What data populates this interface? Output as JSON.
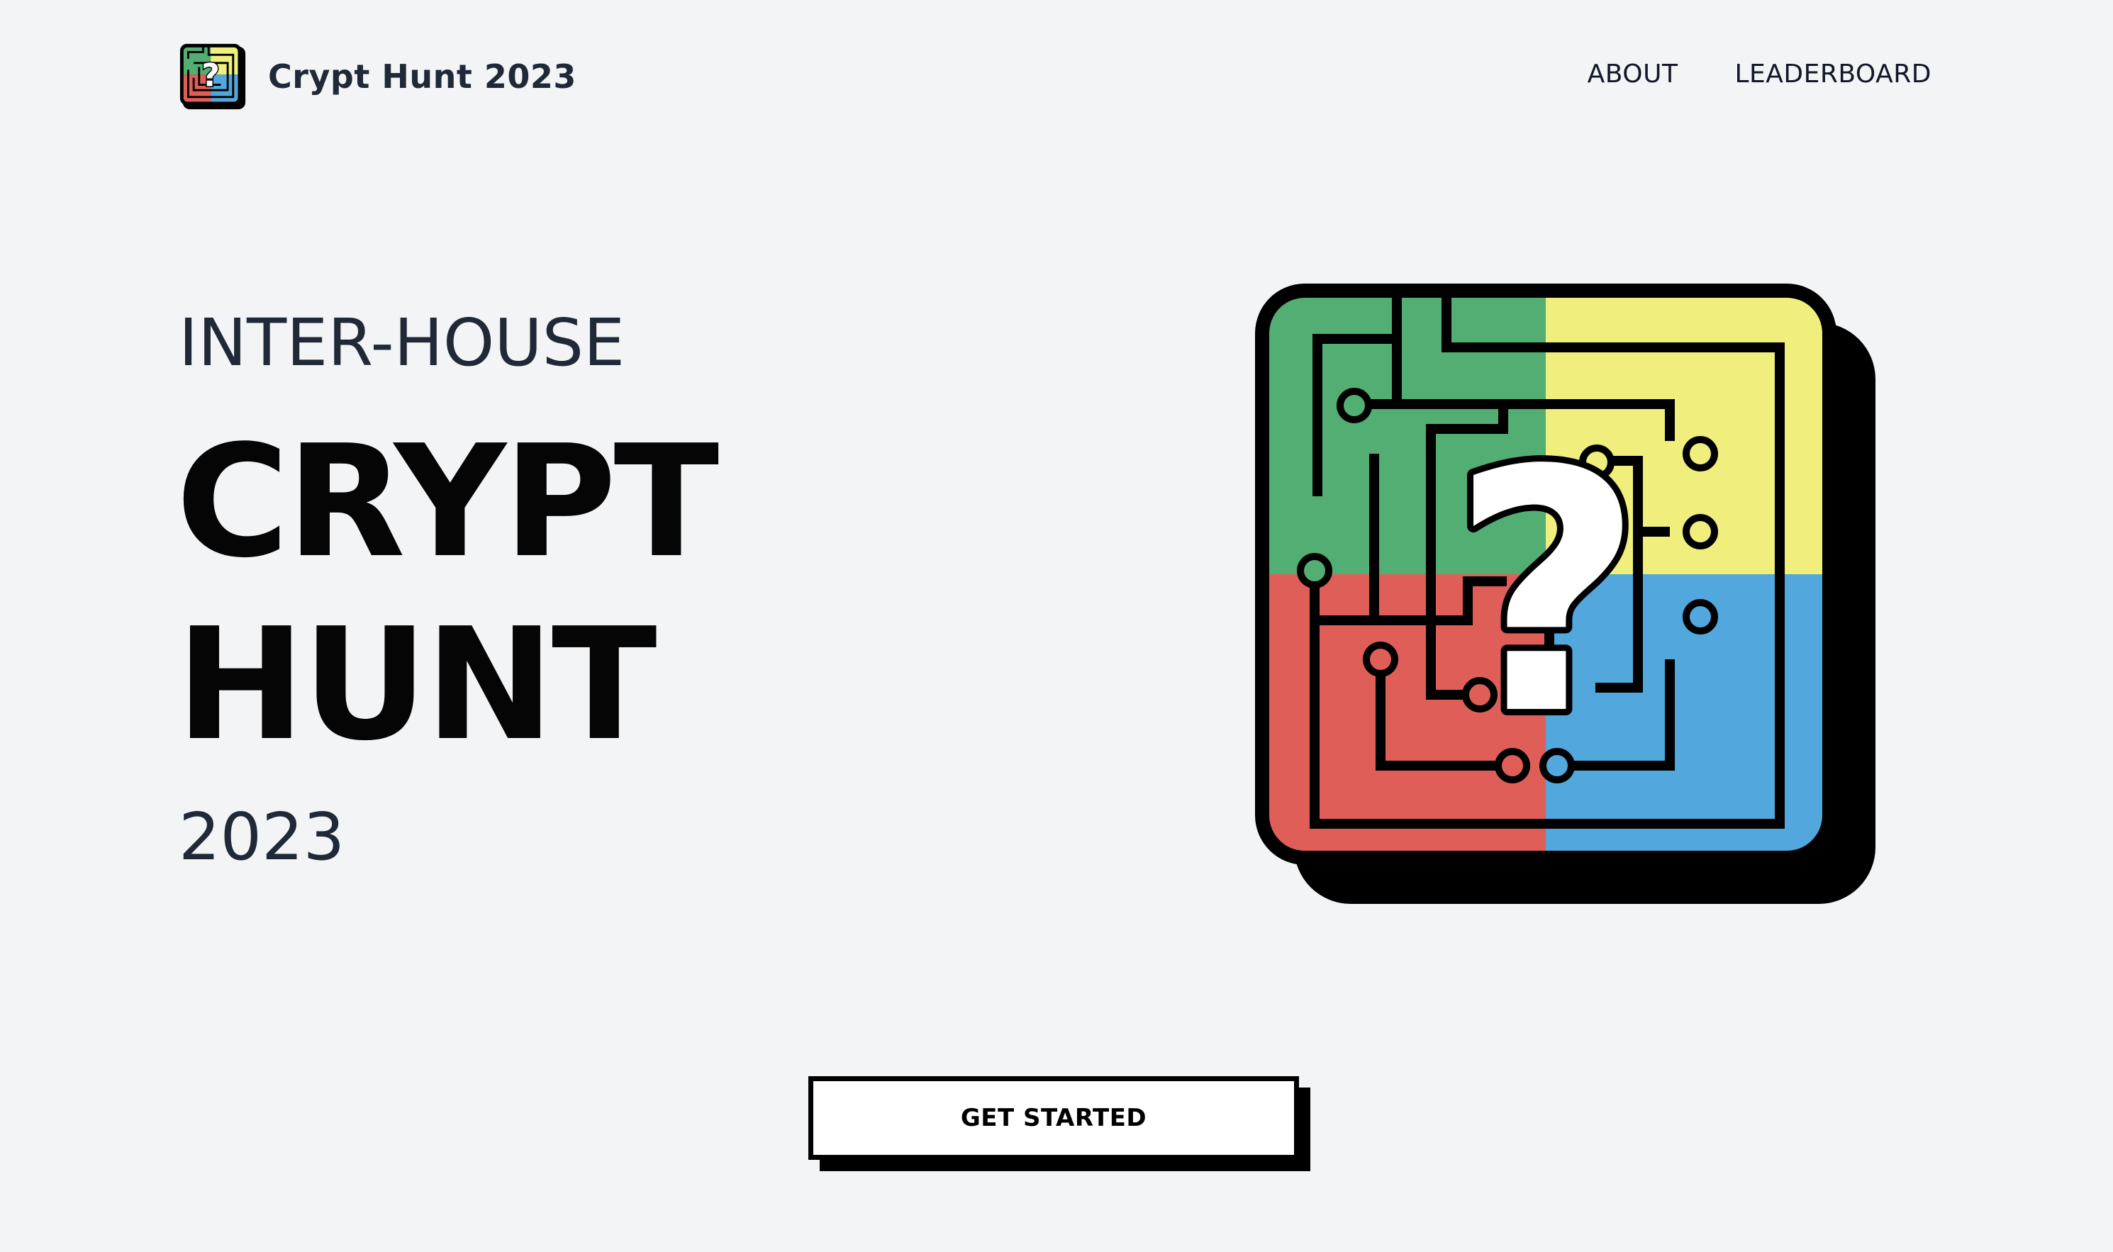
{
  "header": {
    "brand_name": "Crypt Hunt 2023",
    "logo_icon": "maze-question-logo-icon",
    "nav": [
      {
        "label": "ABOUT"
      },
      {
        "label": "LEADERBOARD"
      }
    ]
  },
  "hero": {
    "subtitle": "INTER-HOUSE",
    "title_line1": "CRYPT",
    "title_line2": "HUNT",
    "year": "2023",
    "illustration_icon": "maze-question-mark-icon"
  },
  "cta": {
    "label": "GET STARTED"
  },
  "colors": {
    "background": "#f3f4f6",
    "green": "#52ae72",
    "yellow": "#f0ee7c",
    "red": "#df5f58",
    "blue": "#52a7dd",
    "ink": "#000000"
  }
}
